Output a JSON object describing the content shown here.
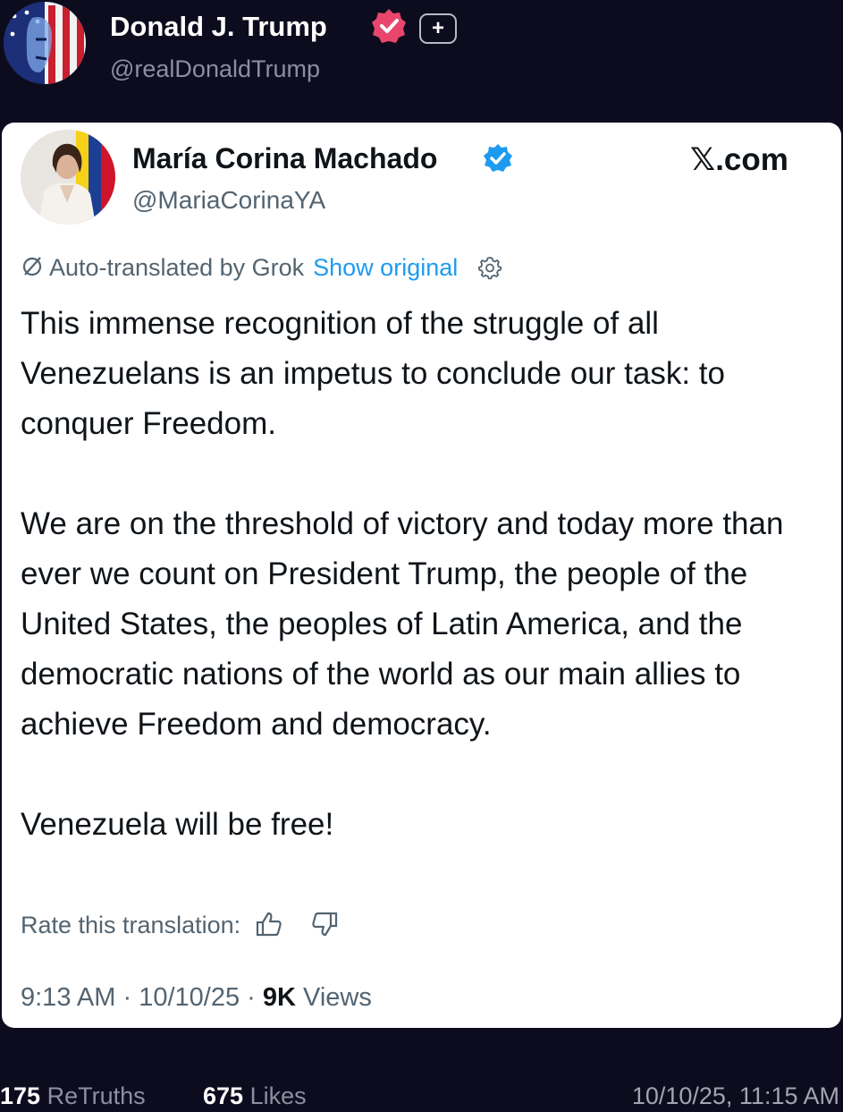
{
  "post": {
    "author_name": "Donald J. Trump",
    "author_handle": "@realDonaldTrump",
    "plus_label": "+"
  },
  "embed": {
    "author_name": "María Corina Machado",
    "author_handle": "@MariaCorinaYA",
    "source": "𝕏.com",
    "translation": {
      "label": "Auto-translated by Grok",
      "show_original": "Show original"
    },
    "paragraphs": [
      "This immense recognition of the struggle of all Venezuelans is an impetus to conclude our task: to conquer Freedom.",
      "We are on the threshold of victory and today more than ever we count on President Trump, the people of the United States, the peoples of Latin America, and the democratic nations of the world as our main allies to achieve Freedom and democracy.",
      "Venezuela will be free!"
    ],
    "rate_label": "Rate this translation:",
    "meta": {
      "time": "9:13 AM",
      "separator": "·",
      "date": "10/10/25",
      "views_count": "9K",
      "views_label": "Views"
    }
  },
  "footer": {
    "retruths_count": "175",
    "retruths_label": "ReTruths",
    "likes_count": "675",
    "likes_label": "Likes",
    "timestamp": "10/10/25, 11:15 AM"
  },
  "colors": {
    "background": "#0d0c1e",
    "truth_verified": "#e8466c",
    "x_verified": "#1d9bf0",
    "link": "#1d9bf0"
  },
  "icons": [
    "verified-badge-icon",
    "plus-icon",
    "translate-icon",
    "gear-icon",
    "thumbs-up-icon",
    "thumbs-down-icon"
  ]
}
